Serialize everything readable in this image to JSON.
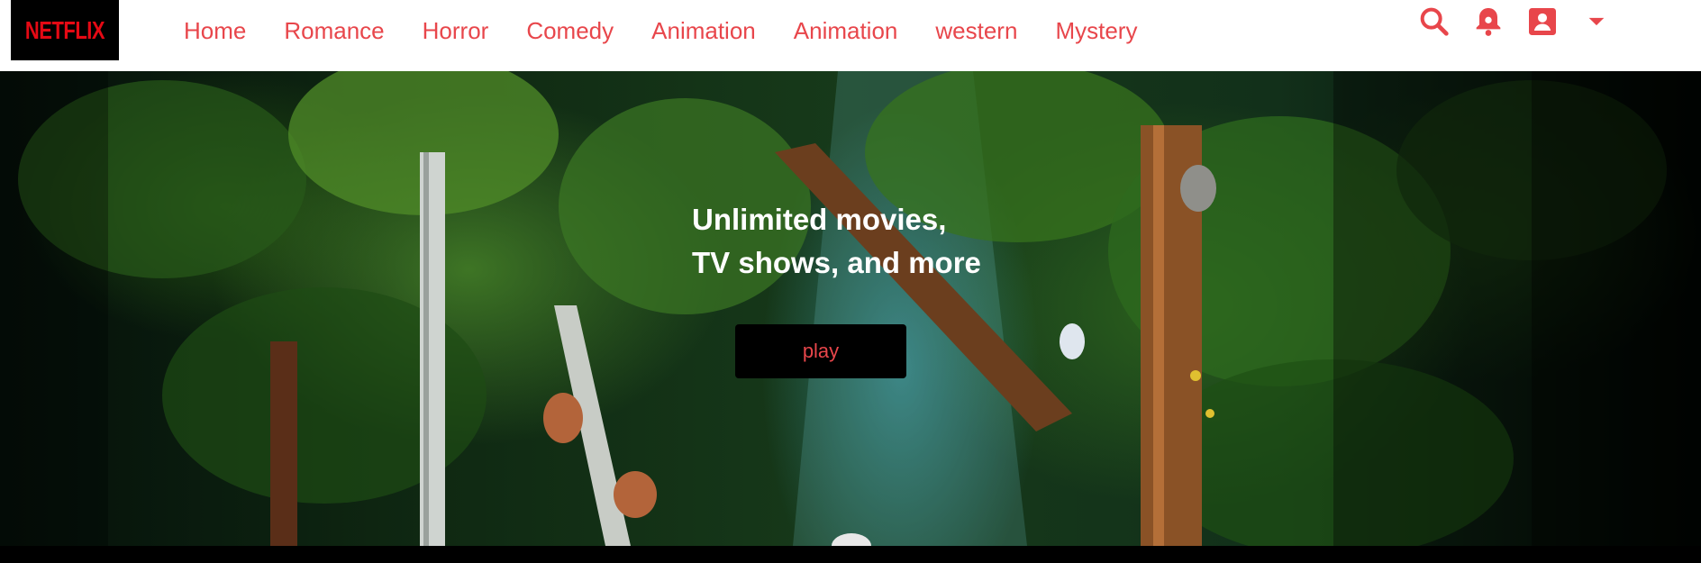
{
  "brand": {
    "logo_text": "NETFLIX",
    "accent_color": "#e50914",
    "link_color": "#e8464b"
  },
  "nav": {
    "links": [
      "Home",
      "Romance",
      "Horror",
      "Comedy",
      "Animation",
      "Animation",
      "western",
      "Mystery"
    ],
    "icons": [
      "search-icon",
      "notification-icon",
      "account-icon",
      "dropdown-arrow-icon"
    ]
  },
  "hero": {
    "headline_line1": "Unlimited movies,",
    "headline_line2": "TV shows, and more",
    "play_label": "play"
  }
}
